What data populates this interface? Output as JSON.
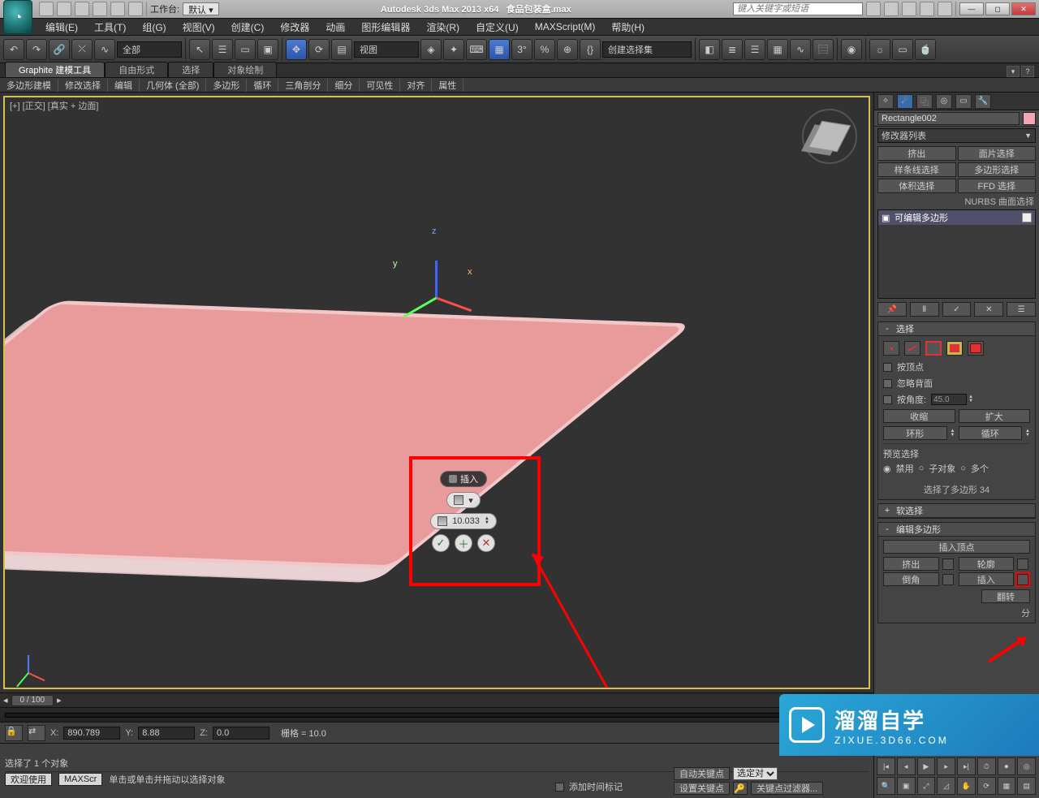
{
  "app": {
    "title_left": "Autodesk 3ds Max  2013 x64",
    "document": "食品包装盒.max",
    "search_placeholder": "键入关键字或短语",
    "workspace_label": "工作台:",
    "workspace_value": "默认"
  },
  "menus": [
    "编辑(E)",
    "工具(T)",
    "组(G)",
    "视图(V)",
    "创建(C)",
    "修改器",
    "动画",
    "图形编辑器",
    "渲染(R)",
    "自定义(U)",
    "MAXScript(M)",
    "帮助(H)"
  ],
  "toolbar": {
    "selection_filter": "全部",
    "refcoord": "视图",
    "named_sets": "创建选择集"
  },
  "ribbon": {
    "tabs": [
      "Graphite 建模工具",
      "自由形式",
      "选择",
      "对象绘制"
    ],
    "groups": [
      "多边形建模",
      "修改选择",
      "编辑",
      "几何体 (全部)",
      "多边形",
      "循环",
      "三角剖分",
      "细分",
      "可见性",
      "对齐",
      "属性"
    ]
  },
  "viewport": {
    "label": "[+] [正交] [真实 + 边面]"
  },
  "caddy": {
    "title": "插入",
    "value": "10.033"
  },
  "cmd": {
    "object_name": "Rectangle002",
    "modifier_list_label": "修改器列表",
    "set_buttons": [
      "挤出",
      "面片选择",
      "样条线选择",
      "多边形选择",
      "体积选择",
      "FFD 选择"
    ],
    "nurbs_label": "NURBS 曲面选择",
    "stack_item": "可编辑多边形",
    "rollup_select": {
      "title": "选择",
      "by_vertex": "按顶点",
      "ignore_backfacing": "忽略背面",
      "by_angle": "按角度:",
      "by_angle_val": "45.0",
      "shrink": "收缩",
      "grow": "扩大",
      "ring": "环形",
      "loop": "循环",
      "preview_label": "预览选择",
      "preview_opts": [
        "禁用",
        "子对象",
        "多个"
      ],
      "selected_msg": "选择了多边形 34"
    },
    "rollup_soft": "软选择",
    "rollup_editpoly": {
      "title": "编辑多边形",
      "insert_vertex": "插入顶点",
      "pairs": [
        [
          "挤出",
          "轮廓"
        ],
        [
          "倒角",
          "插入"
        ]
      ],
      "flip": "翻转"
    }
  },
  "time": {
    "slider": "0 / 100",
    "coords": {
      "x": "890.789",
      "y": "8.88",
      "z": "0.0"
    },
    "grid": "栅格 = 10.0",
    "autokey": "自动关键点",
    "setkey": "设置关键点",
    "selected_set": "选定对",
    "filters": "关键点过滤器...",
    "sel_msg": "选择了 1 个对象",
    "prompt": "单击或单击并拖动以选择对象",
    "add_time_tag": "添加时间标记",
    "welcome": "欢迎使用",
    "maxscr": "MAXScr",
    "extra": "分"
  },
  "watermark": {
    "big": "溜溜自学",
    "small": "ZIXUE.3D66.COM"
  }
}
